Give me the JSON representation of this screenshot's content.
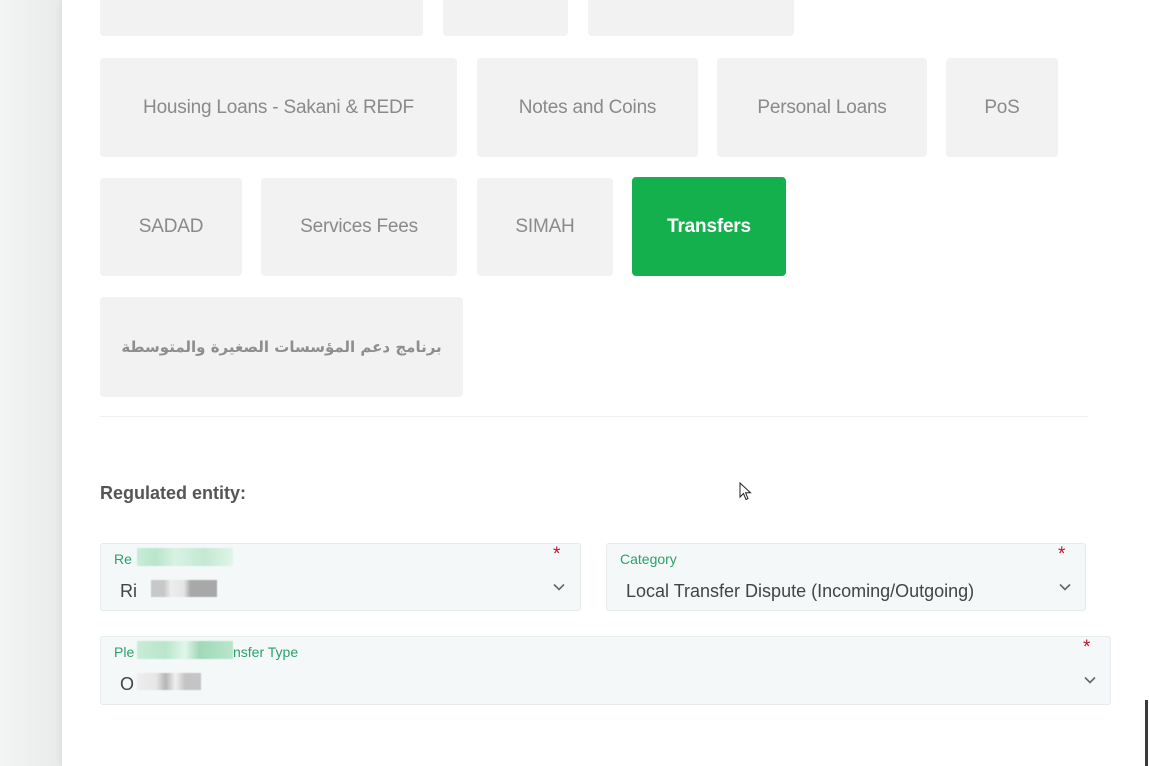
{
  "categories": {
    "top_row_partial": [
      "",
      "",
      ""
    ],
    "row1": [
      "Housing Loans - Sakani & REDF",
      "Notes and Coins",
      "Personal Loans",
      "PoS"
    ],
    "row2": [
      "SADAD",
      "Services Fees",
      "SIMAH",
      "Transfers"
    ],
    "row3": [
      "برنامج دعم المؤسسات الصغيرة والمتوسطة"
    ],
    "selected": "Transfers"
  },
  "form": {
    "section_label": "Regulated entity:",
    "regulated_entity": {
      "label": "Re",
      "value": "Ri",
      "required": "*"
    },
    "category": {
      "label": "Category",
      "value": "Local Transfer Dispute (Incoming/Outgoing)",
      "required": "*"
    },
    "transfer_type": {
      "label_start": "Ple",
      "label_end": "nsfer Type",
      "value": "O",
      "required": "*"
    }
  },
  "colors": {
    "selected_tile": "#15b04e",
    "field_label": "#2ca16d",
    "required_star": "#c8102e"
  }
}
